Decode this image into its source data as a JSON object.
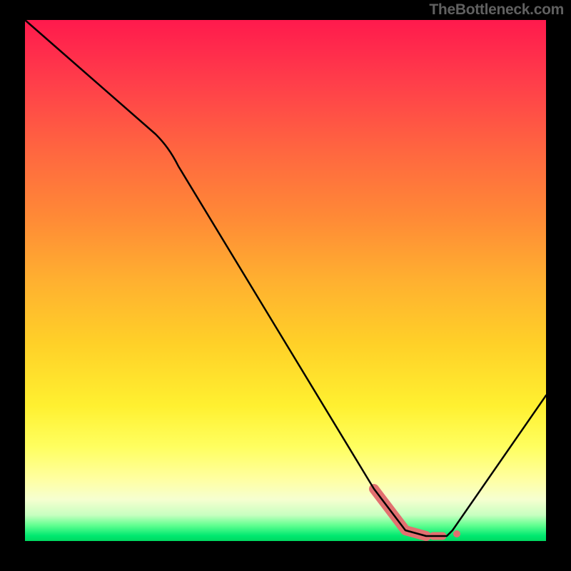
{
  "credit": "TheBottleneck.com",
  "chart_data": {
    "type": "line",
    "title": "",
    "xlabel": "",
    "ylabel": "",
    "xlim": [
      0,
      100
    ],
    "ylim": [
      0,
      100
    ],
    "grid": false,
    "legend": false,
    "x": [
      0,
      25,
      67,
      73,
      77,
      79,
      81,
      82,
      100
    ],
    "values": [
      100,
      78,
      10,
      2,
      1,
      1,
      1,
      2,
      28
    ],
    "series": [
      {
        "name": "curve",
        "x": [
          0,
          25,
          67,
          73,
          77,
          79,
          81,
          82,
          100
        ],
        "values": [
          100,
          78,
          10,
          2,
          1,
          1,
          1,
          2,
          28
        ],
        "stroke": "#000000",
        "width": 2
      },
      {
        "name": "highlight-segment",
        "x": [
          67,
          73,
          77
        ],
        "values": [
          10,
          2,
          1
        ],
        "stroke": "#e27070",
        "width": 10
      },
      {
        "name": "highlight-dot-1",
        "x": [
          79
        ],
        "values": [
          1
        ],
        "stroke": "#e27070",
        "width": 10
      },
      {
        "name": "highlight-dot-2",
        "x": [
          81
        ],
        "values": [
          1
        ],
        "stroke": "#e27070",
        "width": 7
      }
    ]
  }
}
